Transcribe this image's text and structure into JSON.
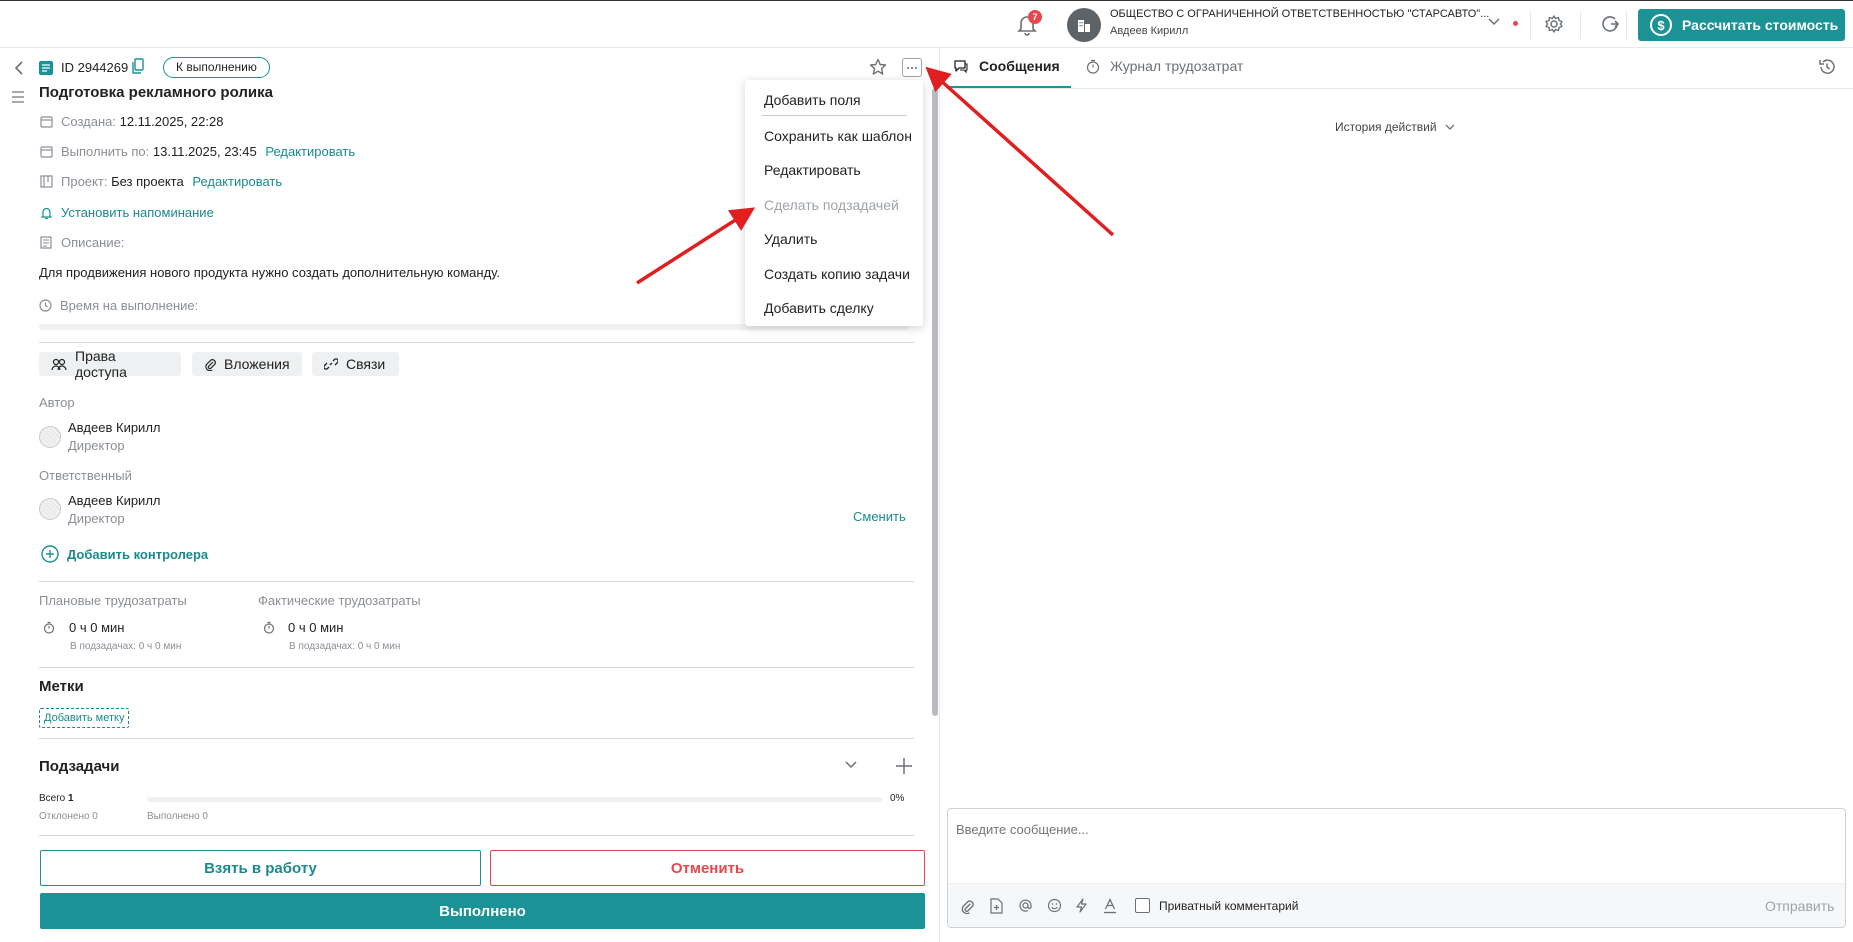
{
  "header": {
    "notifications_count": "7",
    "org_name": "ОБЩЕСТВО С ОГРАНИЧЕННОЙ ОТВЕТСТВЕННОСТЬЮ \"СТАРСАВТО\"...",
    "user_name": "Авдеев Кирилл",
    "calc_button": "Рассчитать стоимость",
    "calc_icon": "$",
    "accent_color": "#1a9296"
  },
  "task": {
    "id_label": "ID 2944269",
    "status": "К выполнению",
    "title": "Подготовка рекламного ролика",
    "created_label": "Создана:",
    "created_value": "12.11.2025, 22:28",
    "due_label": "Выполнить по:",
    "due_value": "13.11.2025, 23:45",
    "edit_link": "Редактировать",
    "project_label": "Проект:",
    "project_value": "Без проекта",
    "reminder": "Установить напоминание",
    "description_label": "Описание:",
    "description": "Для продвижения нового продукта нужно создать дополнительную команду.",
    "time_label": "Время на выполнение:"
  },
  "tabs_left": {
    "access": "Права доступа",
    "attachments": "Вложения",
    "links": "Связи"
  },
  "people": {
    "author_label": "Автор",
    "author_name": "Авдеев Кирилл",
    "author_role": "Директор",
    "responsible_label": "Ответственный",
    "responsible_name": "Авдеев Кирилл",
    "responsible_role": "Директор",
    "change_link": "Сменить",
    "add_controller": "Добавить контролера"
  },
  "labor": {
    "planned_label": "Плановые трудозатраты",
    "planned_value": "0 ч 0 мин",
    "planned_sub": "В подзадачах: 0 ч 0 мин",
    "actual_label": "Фактические трудозатраты",
    "actual_value": "0 ч 0 мин",
    "actual_sub": "В подзадачах: 0 ч 0 мин"
  },
  "tags": {
    "title": "Метки",
    "add_tag": "Добавить метку"
  },
  "subtasks": {
    "title": "Подзадачи",
    "total_label": "Всего",
    "total_value": "1",
    "rejected": "Отклонено 0",
    "done": "Выполнено 0",
    "percent": "0%",
    "progress": 0
  },
  "actions": {
    "take": "Взять в работу",
    "cancel": "Отменить",
    "complete": "Выполнено"
  },
  "menu": {
    "items": [
      {
        "label": "Добавить поля"
      },
      {
        "label": "Сохранить как шаблон"
      },
      {
        "label": "Редактировать"
      },
      {
        "label": "Сделать подзадачей"
      },
      {
        "label": "Удалить"
      },
      {
        "label": "Создать копию задачи"
      },
      {
        "label": "Добавить сделку"
      }
    ]
  },
  "right": {
    "tab_messages": "Сообщения",
    "tab_journal": "Журнал трудозатрат",
    "history": "История действий",
    "message_placeholder": "Введите сообщение...",
    "private_comment": "Приватный комментарий",
    "send": "Отправить"
  },
  "arrow_color": "#e02020"
}
